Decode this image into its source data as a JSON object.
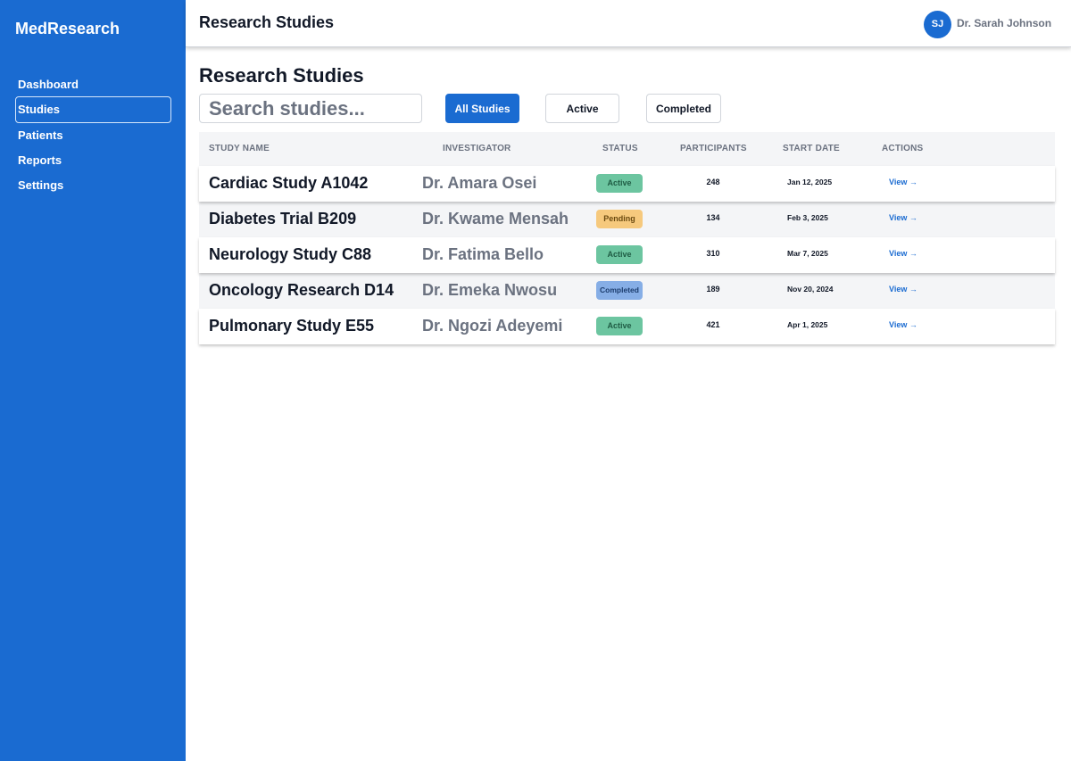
{
  "app": {
    "brand": "MedResearch"
  },
  "sidebar": {
    "items": [
      {
        "label": "Dashboard"
      },
      {
        "label": "Studies"
      },
      {
        "label": "Patients"
      },
      {
        "label": "Reports"
      },
      {
        "label": "Settings"
      }
    ],
    "active_index": 1
  },
  "header": {
    "title": "Research Studies",
    "user": {
      "initials": "SJ",
      "name": "Dr. Sarah Johnson"
    }
  },
  "main": {
    "title": "Research Studies",
    "search": {
      "placeholder": "Search studies...",
      "value": ""
    },
    "filters": [
      {
        "label": "All Studies",
        "selected": true
      },
      {
        "label": "Active",
        "selected": false
      },
      {
        "label": "Completed",
        "selected": false
      }
    ]
  },
  "table": {
    "columns": [
      "Study Name",
      "Investigator",
      "Status",
      "Participants",
      "Start Date",
      "Actions"
    ],
    "rows": [
      {
        "name": "Cardiac Study A1042",
        "investigator": "Dr. Amara Osei",
        "status": "Active",
        "participants": "248",
        "start_date": "Jan 12, 2025",
        "action": "View →"
      },
      {
        "name": "Diabetes Trial B209",
        "investigator": "Dr. Kwame Mensah",
        "status": "Pending",
        "participants": "134",
        "start_date": "Feb 3, 2025",
        "action": "View →"
      },
      {
        "name": "Neurology Study C88",
        "investigator": "Dr. Fatima Bello",
        "status": "Active",
        "participants": "310",
        "start_date": "Mar 7, 2025",
        "action": "View →"
      },
      {
        "name": "Oncology Research D14",
        "investigator": "Dr. Emeka Nwosu",
        "status": "Completed",
        "participants": "189",
        "start_date": "Nov 20, 2024",
        "action": "View →"
      },
      {
        "name": "Pulmonary Study E55",
        "investigator": "Dr. Ngozi Adeyemi",
        "status": "Active",
        "participants": "421",
        "start_date": "Apr 1, 2025",
        "action": "View →"
      }
    ]
  },
  "colors": {
    "primary": "#1a6bd1",
    "status_active": "#6cc5a0",
    "status_pending": "#f6c97d",
    "status_completed": "#86aee6"
  }
}
